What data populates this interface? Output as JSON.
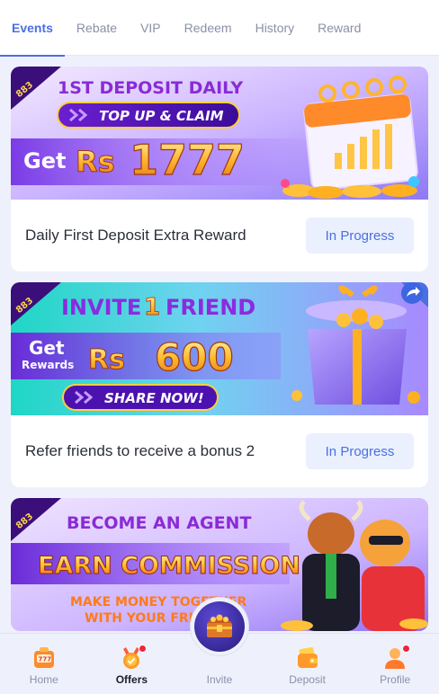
{
  "tabs": [
    {
      "label": "Events",
      "active": true
    },
    {
      "label": "Rebate",
      "active": false
    },
    {
      "label": "VIP",
      "active": false
    },
    {
      "label": "Redeem",
      "active": false
    },
    {
      "label": "History",
      "active": false
    },
    {
      "label": "Reward",
      "active": false
    }
  ],
  "cards": [
    {
      "banner": {
        "badge": "883",
        "headline": "1ST DEPOSIT DAILY",
        "pill": "TOP UP & CLAIM",
        "get": "Get",
        "currency": "Rs",
        "amount": "1777"
      },
      "title": "Daily First Deposit Extra Reward",
      "status": "In Progress"
    },
    {
      "banner": {
        "badge": "883",
        "headline_a": "INVITE",
        "headline_num": "1",
        "headline_b": "FRIEND",
        "get": "Get",
        "rewards": "Rewards",
        "currency": "Rs",
        "amount": "600",
        "pill": "SHARE NOW!"
      },
      "title": "Refer friends to receive a bonus 2",
      "status": "In Progress"
    },
    {
      "banner": {
        "badge": "883",
        "headline": "BECOME AN AGENT",
        "big": "EARN COMMISSION",
        "line1": "MAKE MONEY TOGETHER",
        "line2": "WITH YOUR FRI"
      }
    }
  ],
  "nav": [
    {
      "label": "Home",
      "icon": "slot-machine-icon",
      "active": false,
      "dot": false
    },
    {
      "label": "Offers",
      "icon": "medal-icon",
      "active": true,
      "dot": true
    },
    {
      "label": "Invite",
      "icon": "treasure-chest-icon",
      "active": false,
      "dot": false
    },
    {
      "label": "Deposit",
      "icon": "wallet-icon",
      "active": false,
      "dot": false
    },
    {
      "label": "Profile",
      "icon": "user-icon",
      "active": false,
      "dot": true
    }
  ],
  "colors": {
    "accent": "#4a6fe3",
    "status_bg": "#eaf0fd",
    "badge_dot": "#f0233b",
    "page_bg": "#eef1fb"
  }
}
